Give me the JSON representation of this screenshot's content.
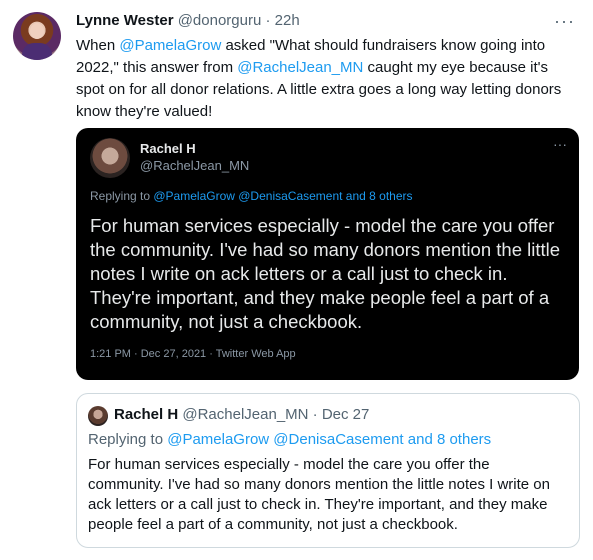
{
  "tweet": {
    "author_name": "Lynne Wester",
    "author_handle": "@donorguru",
    "separator": "·",
    "time": "22h",
    "more": "···",
    "text_parts": [
      "When ",
      "@PamelaGrow",
      " asked \"What should fundraisers know going into 2022,\" this answer from ",
      "@RachelJean_MN",
      " caught my eye because it's spot on for all donor relations. A little extra goes a long way letting donors know they're valued!"
    ]
  },
  "screenshot": {
    "name": "Rachel H",
    "handle": "@RachelJean_MN",
    "more": "···",
    "replying_prefix": "Replying to ",
    "replying_to": "@PamelaGrow @DenisaCasement and 8 others",
    "text": "For human services especially - model the care you offer the community. I've had so many donors mention the little notes I write on ack letters or a call just to check in. They're important, and they make people feel a part of a community, not just a checkbook.",
    "meta": "1:21 PM · Dec 27, 2021 · Twitter Web App"
  },
  "quote": {
    "name": "Rachel H",
    "handle": "@RachelJean_MN",
    "separator": "·",
    "date": "Dec 27",
    "replying_prefix": "Replying to ",
    "replying_to": "@PamelaGrow @DenisaCasement",
    "replying_suffix": " and 8 others",
    "text": "For human services especially - model the care you offer the community. I've had so many donors mention the little notes I write on ack letters or a call just to check in. They're important, and they make people feel a part of a community, not just a checkbook."
  }
}
